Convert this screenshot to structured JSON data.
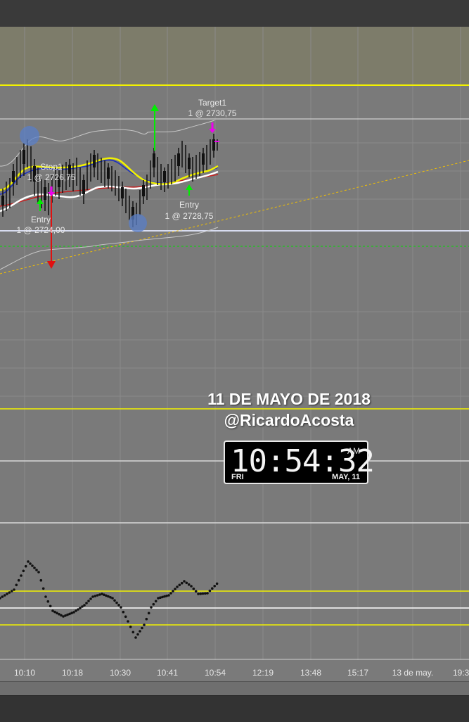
{
  "orders": {
    "target": {
      "name": "Target1",
      "detail": "1 @ 2730,75"
    },
    "stop": {
      "name": "Stop1",
      "detail": "1 @ 2726,75"
    },
    "entry_left": {
      "name": "Entry",
      "detail": "1 @ 2724,00"
    },
    "entry_right": {
      "name": "Entry",
      "detail": "1 @ 2728,75"
    }
  },
  "overlay": {
    "date": "11 DE MAYO DE 2018",
    "author": "@RicardoAcosta"
  },
  "clock": {
    "time": "10:54:32",
    "ampm": "AM",
    "day": "FRI",
    "date": "MAY, 11"
  },
  "time_axis": {
    "labels": [
      "10:10",
      "10:18",
      "10:30",
      "10:41",
      "10:54",
      "12:19",
      "13:48",
      "15:17",
      "13 de may.",
      "19:3"
    ]
  },
  "colors": {
    "background": "#7a7a7a",
    "highlight_band": "#7d7c6a",
    "yellow": "#f2f200",
    "white": "#ffffff",
    "green": "#00ee00",
    "red": "#e01010",
    "magenta": "#ee00ee",
    "blue": "#1a2ec0"
  }
}
